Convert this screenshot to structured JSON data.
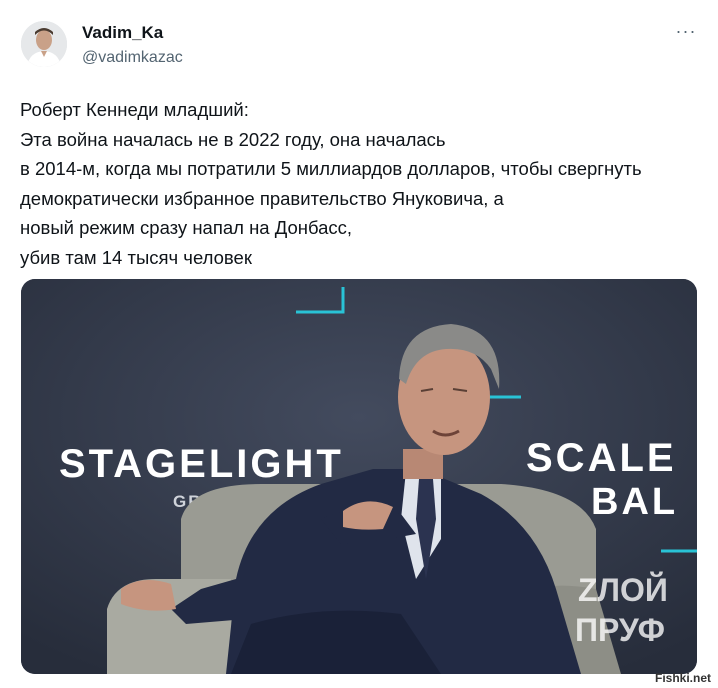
{
  "author": {
    "display_name": "Vadim_Ka",
    "handle": "@vadimkazac",
    "avatar_icon": "avatar-photo"
  },
  "more_button": {
    "icon": "ellipsis-icon",
    "label": "···"
  },
  "tweet_text": [
    "Роберт Кеннеди младший:",
    "Эта война началась не в 2022 году, она началась",
    "в 2014-м, когда мы потратили 5 миллиардов долларов, чтобы свергнуть",
    "демократически избранное правительство Януковича, а",
    "новый режим сразу напал на Донбасс,",
    "убив там 14 тысяч человек"
  ],
  "media": {
    "stage_text_left": "STAGELIGHT",
    "stage_text_left_sub": "GROU",
    "stage_text_right": "SCALE",
    "stage_text_right_sub": "BAL",
    "overlay_logo_line1": "ZЛОЙ",
    "overlay_logo_line2": "ПРУФ"
  },
  "watermark": "Fishki.net",
  "colors": {
    "stage_background": "#353c4d",
    "accent_cyan": "#29c3d6",
    "text_primary": "#0f1419",
    "text_secondary": "#536471"
  }
}
